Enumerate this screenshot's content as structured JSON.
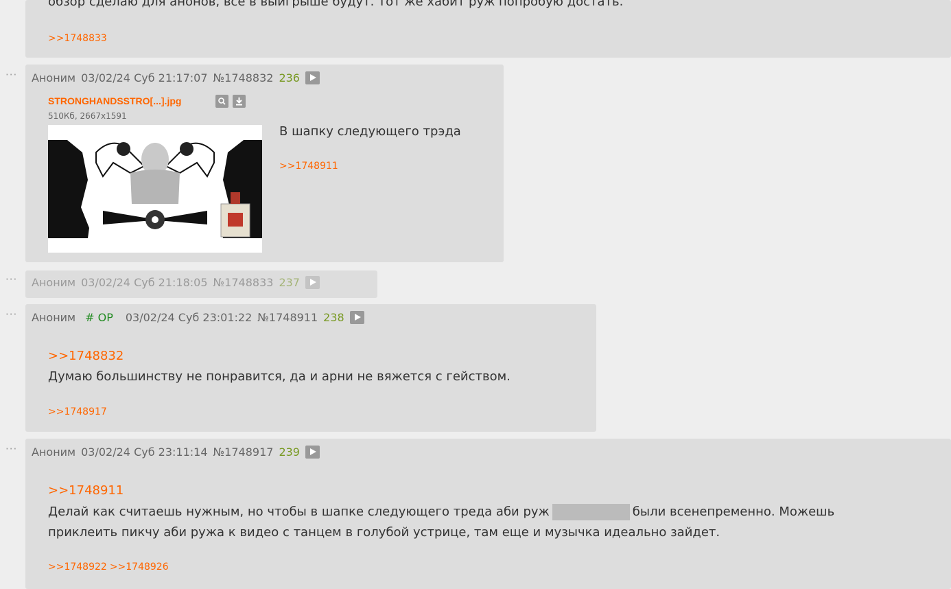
{
  "post_top": {
    "text_tail": "обзор сделаю для анонов, все в выигрыше будут. Тот же хабит руж попробую достать.",
    "replies": [
      ">>1748833"
    ]
  },
  "post_236": {
    "author": "Аноним",
    "datetime": "03/02/24 Суб 21:17:07",
    "number": "№1748832",
    "index": "236",
    "file": {
      "name": "STRONGHANDSSTRO[...].jpg",
      "meta": "510Кб, 2667x1591"
    },
    "text": "В шапку следующего трэда",
    "replies": [
      ">>1748911"
    ]
  },
  "post_237": {
    "author": "Аноним",
    "datetime": "03/02/24 Суб 21:18:05",
    "number": "№1748833",
    "index": "237"
  },
  "post_238": {
    "author": "Аноним",
    "op_tag": "# OP",
    "datetime": "03/02/24 Суб 23:01:22",
    "number": "№1748911",
    "index": "238",
    "quote": ">>1748832",
    "text": "Думаю большинству не понравится, да и арни не вяжется с гейством.",
    "replies": [
      ">>1748917"
    ]
  },
  "post_239": {
    "author": "Аноним",
    "datetime": "03/02/24 Суб 23:11:14",
    "number": "№1748917",
    "index": "239",
    "quote": ">>1748911",
    "text_before_spoiler": "Делай как считаешь нужным, но чтобы в шапке следующего треда аби руж",
    "text_after_spoiler": "были всенепременно. Можешь",
    "text_line2": "приклеить пикчу аби ружа к видео с танцем в голубой устрице, там еще и музычка идеально зайдет.",
    "replies": [
      ">>1748922",
      ">>1748926"
    ]
  },
  "icons": {
    "more": "ellipsis-icon",
    "play": "play-icon",
    "search": "magnifier-icon",
    "download": "download-icon"
  }
}
